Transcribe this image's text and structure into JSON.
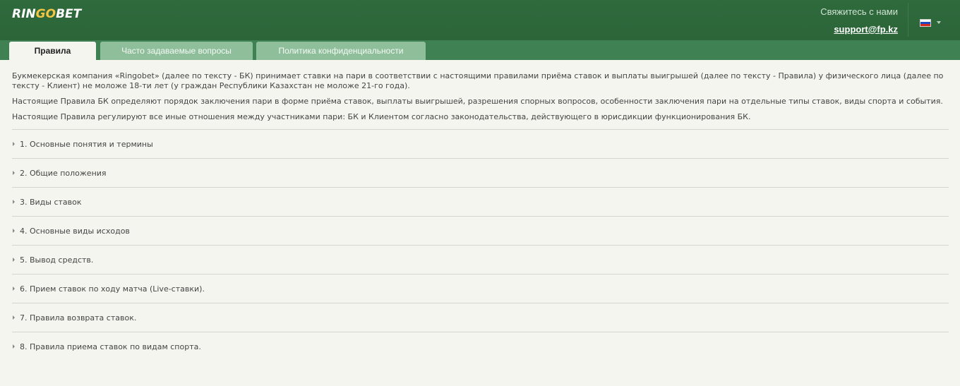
{
  "header": {
    "logo_part1": "RIN",
    "logo_part2": "GO",
    "logo_part3": "BET",
    "contact_label": "Свяжитесь с нами",
    "contact_email": "support@fp.kz",
    "language_flag": "russian-flag-icon"
  },
  "tabs": [
    {
      "label": "Правила",
      "active": true
    },
    {
      "label": "Часто задаваемые вопросы",
      "active": false
    },
    {
      "label": "Политика конфиденциальности",
      "active": false
    }
  ],
  "intro": [
    "Букмекерская компания «Ringobet» (далее по тексту - БК) принимает ставки на пари в соответствии с настоящими правилами приёма ставок и выплаты выигрышей (далее по тексту - Правила) у физического лица (далее по тексту - Клиент) не моложе 18-ти лет (у граждан Республики Казахстан не моложе 21-го года).",
    "Настоящие Правила БК определяют порядок заключения пари в форме приёма ставок, выплаты выигрышей, разрешения спорных вопросов, особенности заключения пари на отдельные типы ставок, виды спорта и события.",
    "Настоящие Правила регулируют все иные отношения между участниками пари: БК и Клиентом согласно законодательства, действующего в юрисдикции функционирования БК."
  ],
  "sections": [
    "1. Основные понятия и термины",
    "2. Общие положения",
    "3. Виды ставок",
    "4. Основные виды исходов",
    "5. Вывод средств.",
    "6. Прием ставок по ходу матча (Live-ставки).",
    "7. Правила возврата ставок.",
    "8. Правила приема ставок по видам спорта."
  ],
  "colors": {
    "header_bg": "#2f6a3d",
    "tabbar_bg": "#3f8152",
    "inactive_tab": "#8fbe9b",
    "page_bg": "#f5f5f0",
    "logo_accent": "#f4c542"
  }
}
